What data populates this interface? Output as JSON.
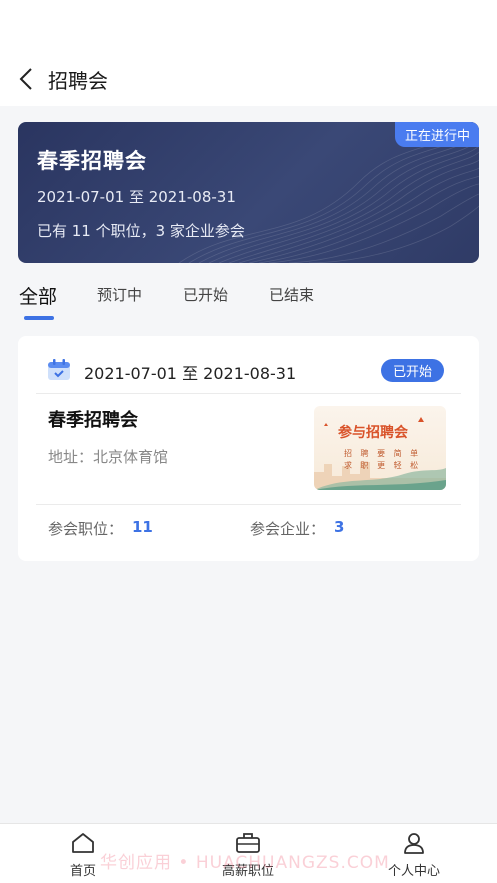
{
  "header": {
    "title": "招聘会"
  },
  "banner": {
    "badge": "正在进行中",
    "title": "春季招聘会",
    "dates": "2021-07-01 至 2021-08-31",
    "stats": "已有 11 个职位，3 家企业参会"
  },
  "tabs": [
    {
      "label": "全部",
      "active": true
    },
    {
      "label": "预订中",
      "active": false
    },
    {
      "label": "已开始",
      "active": false
    },
    {
      "label": "已结束",
      "active": false
    }
  ],
  "card": {
    "dates": "2021-07-01 至 2021-08-31",
    "status": "已开始",
    "title": "春季招聘会",
    "address": "地址：北京体育馆",
    "poster_title": "参与招聘会",
    "poster_line1": "招 聘 要 简 单",
    "poster_line2": "求 职 更 轻 松",
    "positions_label": "参会职位：",
    "positions_value": "11",
    "companies_label": "参会企业：",
    "companies_value": "3"
  },
  "bottom_nav": [
    {
      "label": "首页",
      "icon": "home-icon"
    },
    {
      "label": "高薪职位",
      "icon": "briefcase-icon"
    },
    {
      "label": "个人中心",
      "icon": "user-icon"
    }
  ],
  "watermark": "华创应用 • HUACHUANGZS.COM",
  "colors": {
    "accent": "#3d72e4",
    "banner": "#2f3b66"
  }
}
